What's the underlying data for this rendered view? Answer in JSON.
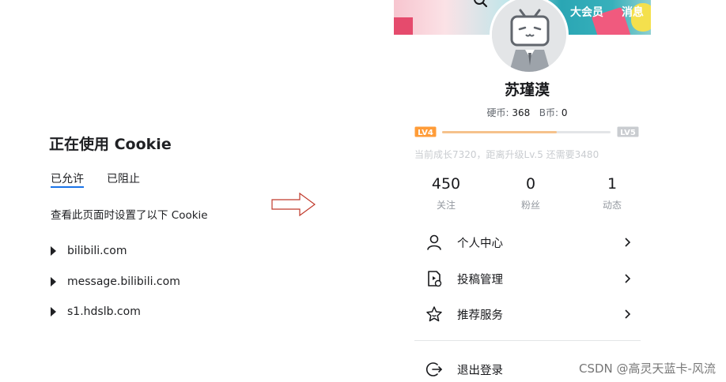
{
  "cookie_panel": {
    "title": "正在使用 Cookie",
    "tabs": [
      {
        "label": "已允许",
        "active": true
      },
      {
        "label": "已阻止",
        "active": false
      }
    ],
    "description": "查看此页面时设置了以下 Cookie",
    "sites": [
      "bilibili.com",
      "message.bilibili.com",
      "s1.hdslb.com"
    ]
  },
  "user_panel": {
    "header_links": {
      "vip": "大会员",
      "messages": "消息"
    },
    "username": "苏瑾漠",
    "coins": {
      "label": "硬币:",
      "value": "368",
      "bcoin_label": "B币:",
      "bcoin_value": "0"
    },
    "level": {
      "current": "LV4",
      "next": "LV5",
      "progress": 0.68,
      "tip": "当前成长7320，距离升级Lv.5 还需要3480"
    },
    "stats": [
      {
        "value": "450",
        "label": "关注"
      },
      {
        "value": "0",
        "label": "粉丝"
      },
      {
        "value": "1",
        "label": "动态"
      }
    ],
    "menu": [
      {
        "label": "个人中心",
        "icon": "user-icon"
      },
      {
        "label": "投稿管理",
        "icon": "upload-manage-icon"
      },
      {
        "label": "推荐服务",
        "icon": "recommend-service-icon"
      }
    ],
    "logout": {
      "label": "退出登录",
      "icon": "logout-icon"
    }
  },
  "watermark": "CSDN @高灵天蓝卡-风流",
  "colors": {
    "accent_blue": "#1a73e8",
    "level_fill": "#f6c28b",
    "lv4_orange": "#ff9c38",
    "lv5": "#c9ccd0"
  }
}
